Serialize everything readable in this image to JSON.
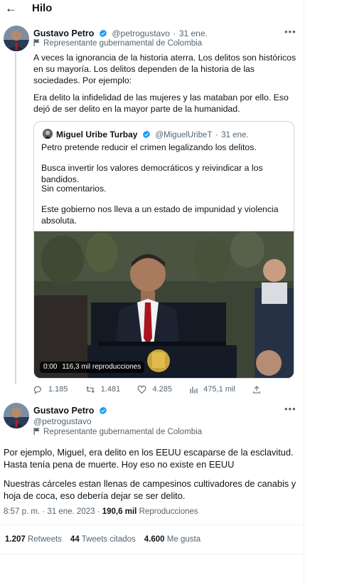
{
  "header": {
    "back_icon": "arrow-left-icon",
    "title": "Hilo"
  },
  "tweet1": {
    "name": "Gustavo Petro",
    "handle": "@petrogustavo",
    "dot": "·",
    "date": "31 ene.",
    "label": "Representante gubernamental de Colombia",
    "paragraph1": "A veces la ignorancia de la historia aterra. Los delitos son históricos en su mayoría. Los delitos dependen de la historia de las sociedades. Por ejemplo:",
    "paragraph2": "Era delito la infidelidad de las mujeres y las mataban por ello. Eso dejó de ser delito en la mayor parte de la humanidad."
  },
  "quote": {
    "name": "Miguel Uribe Turbay",
    "handle": "@MiguelUribeT",
    "dot": "·",
    "date": "31 ene.",
    "p1": "Petro pretende reducir el crimen legalizando los delitos.",
    "p2": "Busca invertir los valores democráticos y reivindicar a los bandidos.",
    "p3": "Sin comentarios.",
    "p4": "Este gobierno nos lleva a un estado de impunidad y violencia absoluta.",
    "video_time": "0:00",
    "video_views": "116,3 mil reproducciones"
  },
  "actions": {
    "replies": "1.185",
    "retweets": "1.481",
    "likes": "4.285",
    "views": "475,1 mil"
  },
  "tweet2": {
    "name": "Gustavo Petro",
    "handle": "@petrogustavo",
    "label": "Representante gubernamental de Colombia",
    "paragraph1": "Por ejemplo, Miguel, era delito en los EEUU escaparse de la esclavitud. Hasta tenía pena de muerte. Hoy eso no existe en EEUU",
    "paragraph2": "Nuestras cárceles estan llenas de campesinos cultivadores de canabis y hoja de coca, eso debería dejar se ser delito.",
    "time": "8:57 p. m.",
    "date": "31 ene. 2023",
    "views_count": "190,6 mil",
    "views_label": "Reproducciones"
  },
  "stats": {
    "retweets_count": "1.207",
    "retweets_label": "Retweets",
    "quotes_count": "44",
    "quotes_label": "Tweets citados",
    "likes_count": "4.600",
    "likes_label": "Me gusta"
  },
  "colors": {
    "verified": "#1d9bf0",
    "muted": "#536471",
    "text": "#0f1419",
    "border": "#cfd9de"
  }
}
